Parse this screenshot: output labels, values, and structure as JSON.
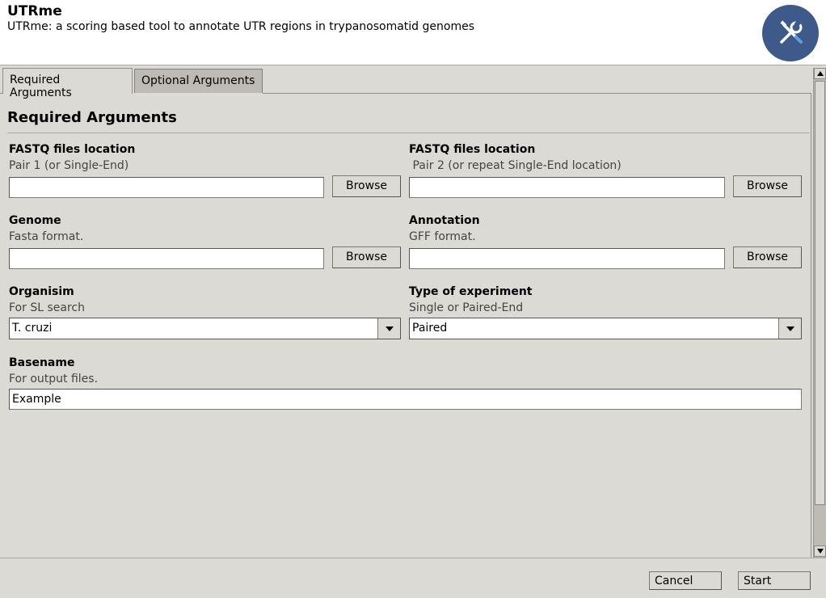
{
  "header": {
    "title": "UTRme",
    "description": "UTRme: a scoring based tool to annotate UTR regions in trypanosomatid genomes",
    "logo_icon": "tools-icon",
    "logo_color": "#3d5a8a"
  },
  "tabs": [
    {
      "label": "Required Arguments",
      "active": true
    },
    {
      "label": "Optional Arguments",
      "active": false
    }
  ],
  "section": {
    "title": "Required Arguments"
  },
  "fields": {
    "fastq1": {
      "label": "FASTQ files location",
      "help": "Pair 1 (or Single-End)",
      "value": "",
      "button": "Browse"
    },
    "fastq2": {
      "label": "FASTQ files location",
      "help": " Pair 2 (or repeat Single-End location)",
      "value": "",
      "button": "Browse"
    },
    "genome": {
      "label": "Genome",
      "help": "Fasta format.",
      "value": "",
      "button": "Browse"
    },
    "annotation": {
      "label": "Annotation",
      "help": "GFF format.",
      "value": "",
      "button": "Browse"
    },
    "organism": {
      "label": "Organisim",
      "help": "For SL search",
      "value": "T. cruzi"
    },
    "experiment": {
      "label": "Type of experiment",
      "help": "Single or Paired-End",
      "value": "Paired"
    },
    "basename": {
      "label": "Basename",
      "help": "For output files.",
      "value": "Example"
    }
  },
  "footer": {
    "cancel": "Cancel",
    "start": "Start"
  }
}
